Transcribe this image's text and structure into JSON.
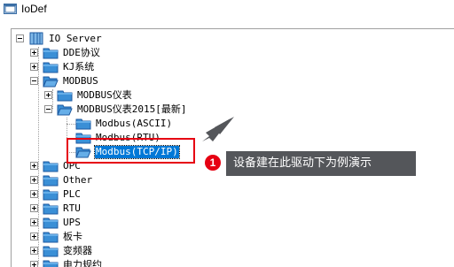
{
  "window": {
    "title": "IoDef"
  },
  "tree": {
    "root": "IO Server",
    "items": [
      {
        "label": "DDE协议"
      },
      {
        "label": "KJ系统"
      },
      {
        "label": "MODBUS"
      },
      {
        "label": "MODBUS仪表"
      },
      {
        "label": "MODBUS仪表2015[最新]"
      },
      {
        "label": "Modbus(ASCII)"
      },
      {
        "label": "Modbus(RTU)"
      },
      {
        "label": "Modbus(TCP/IP)"
      },
      {
        "label": "OPC"
      },
      {
        "label": "Other"
      },
      {
        "label": "PLC"
      },
      {
        "label": "RTU"
      },
      {
        "label": "UPS"
      },
      {
        "label": "板卡"
      },
      {
        "label": "变频器"
      },
      {
        "label": "电力规约"
      }
    ]
  },
  "annotation": {
    "badge": "1",
    "text": "设备建在此驱动下为例演示"
  },
  "colors": {
    "accent": "#e60012",
    "selection": "#0078d7",
    "callout_bg": "#54565a",
    "folder": "#3a8fd6"
  }
}
